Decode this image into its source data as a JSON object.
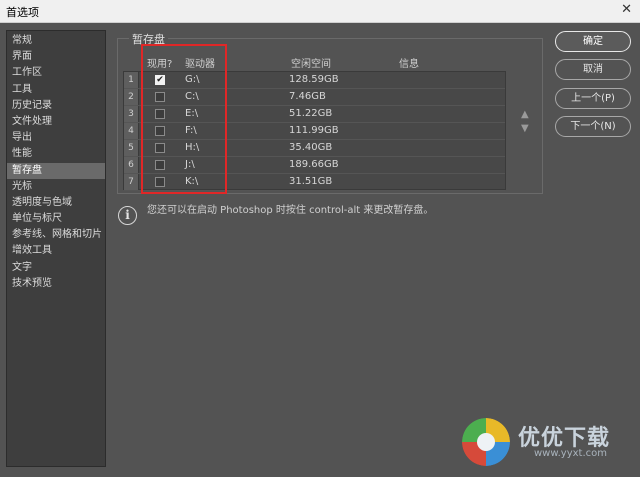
{
  "window": {
    "title": "首选项",
    "close_glyph": "✕"
  },
  "sidebar": {
    "items": [
      {
        "label": "常规"
      },
      {
        "label": "界面"
      },
      {
        "label": "工作区"
      },
      {
        "label": "工具"
      },
      {
        "label": "历史记录"
      },
      {
        "label": "文件处理"
      },
      {
        "label": "导出"
      },
      {
        "label": "性能"
      },
      {
        "label": "暂存盘",
        "selected": true
      },
      {
        "label": "光标"
      },
      {
        "label": "透明度与色域"
      },
      {
        "label": "单位与标尺"
      },
      {
        "label": "参考线、网格和切片"
      },
      {
        "label": "增效工具"
      },
      {
        "label": "文字"
      },
      {
        "label": "技术预览"
      }
    ]
  },
  "scratch": {
    "group_title": "暂存盘",
    "headers": {
      "active": "现用?",
      "drive": "驱动器",
      "free": "空闲空间",
      "info": "信息"
    },
    "rows": [
      {
        "num": "1",
        "checked": true,
        "drive": "G:\\",
        "free": "128.59GB"
      },
      {
        "num": "2",
        "checked": false,
        "drive": "C:\\",
        "free": "7.46GB"
      },
      {
        "num": "3",
        "checked": false,
        "drive": "E:\\",
        "free": "51.22GB"
      },
      {
        "num": "4",
        "checked": false,
        "drive": "F:\\",
        "free": "111.99GB"
      },
      {
        "num": "5",
        "checked": false,
        "drive": "H:\\",
        "free": "35.40GB"
      },
      {
        "num": "6",
        "checked": false,
        "drive": "J:\\",
        "free": "189.66GB"
      },
      {
        "num": "7",
        "checked": false,
        "drive": "K:\\",
        "free": "31.51GB"
      }
    ],
    "arrow_up": "▲",
    "arrow_down": "▼"
  },
  "info": {
    "icon": "info-icon",
    "text": "您还可以在启动 Photoshop 时按住 control-alt 来更改暂存盘。"
  },
  "buttons": {
    "ok": "确定",
    "cancel": "取消",
    "prev": "上一个(P)",
    "next": "下一个(N)"
  },
  "watermark": {
    "text": "优优下载",
    "url": "www.yyxt.com"
  }
}
